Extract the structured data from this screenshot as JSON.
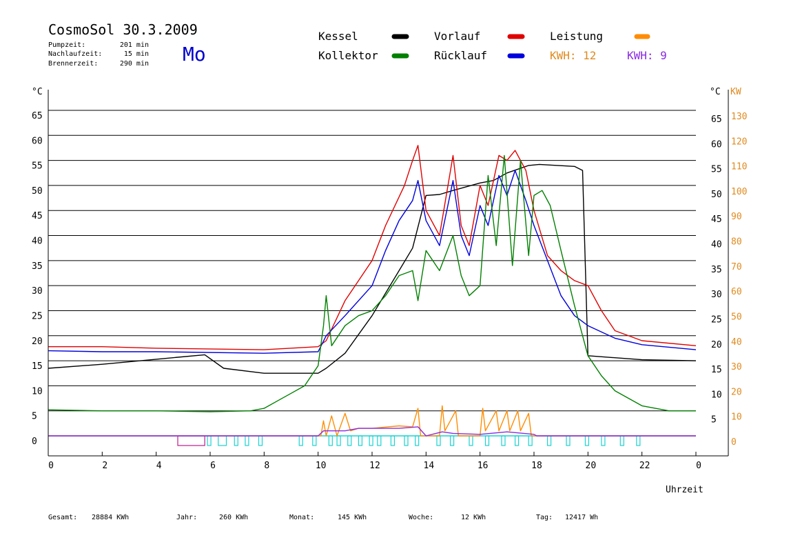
{
  "header": {
    "title": "CosmoSol 30.3.2009",
    "day": "Mo",
    "info": [
      {
        "label": "Pumpzeit:",
        "value": "201 min"
      },
      {
        "label": "Nachlaufzeit:",
        "value": "15 min"
      },
      {
        "label": "Brennerzeit:",
        "value": "290 min"
      }
    ]
  },
  "legend": [
    {
      "label": "Kessel",
      "color": "#000000"
    },
    {
      "label": "Vorlauf",
      "color": "#e00000"
    },
    {
      "label": "Leistung",
      "color": "#ff8c00"
    },
    {
      "label": "Kollektor",
      "color": "#008000"
    },
    {
      "label": "Rücklauf",
      "color": "#0000dd"
    }
  ],
  "kwh": [
    {
      "text": "KWH: 12",
      "color": "#e08a1e"
    },
    {
      "text": "KWH: 9",
      "color": "#8a2be2"
    }
  ],
  "footer": [
    {
      "label": "Gesamt:",
      "value": "28884 KWh"
    },
    {
      "label": "Jahr:",
      "value": "260 KWh"
    },
    {
      "label": "Monat:",
      "value": "145 KWh"
    },
    {
      "label": "Woche:",
      "value": "12 KWh"
    },
    {
      "label": "Tag:",
      "value": "12417 Wh"
    }
  ],
  "chart_data": {
    "type": "line",
    "xlabel": "Uhrzeit",
    "ylabel_left": "°C",
    "ylabel_right_1": "°C",
    "ylabel_right_2": "KW",
    "xlim": [
      0,
      24
    ],
    "ylim": [
      0,
      65
    ],
    "ylim_kw": [
      0,
      130
    ],
    "x_ticks": [
      "0",
      "2",
      "4",
      "6",
      "8",
      "10",
      "12",
      "14",
      "16",
      "18",
      "20",
      "22",
      "0"
    ],
    "y_ticks_left": [
      "65",
      "60",
      "55",
      "50",
      "45",
      "40",
      "35",
      "30",
      "25",
      "20",
      "15",
      "10",
      "5",
      "0"
    ],
    "y_ticks_right": [
      "65",
      "60",
      "55",
      "50",
      "45",
      "40",
      "35",
      "30",
      "25",
      "20",
      "15",
      "10",
      "5"
    ],
    "y_ticks_kw": [
      "130",
      "120",
      "110",
      "100",
      "90",
      "80",
      "70",
      "60",
      "50",
      "40",
      "30",
      "20",
      "10",
      "0"
    ],
    "grid": true,
    "series": [
      {
        "name": "Kessel",
        "color": "#000000",
        "points": [
          [
            0,
            13.5
          ],
          [
            2,
            14.3
          ],
          [
            4,
            15.3
          ],
          [
            5.8,
            16.2
          ],
          [
            6.5,
            13.5
          ],
          [
            8,
            12.5
          ],
          [
            10,
            12.5
          ],
          [
            10.3,
            13.5
          ],
          [
            11,
            16.5
          ],
          [
            12,
            24
          ],
          [
            13,
            33
          ],
          [
            13.5,
            37.5
          ],
          [
            14,
            48
          ],
          [
            14.5,
            48.2
          ],
          [
            15,
            49
          ],
          [
            16,
            50.5
          ],
          [
            16.5,
            51
          ],
          [
            17,
            52.5
          ],
          [
            17.8,
            54
          ],
          [
            18.2,
            54.2
          ],
          [
            19.5,
            53.8
          ],
          [
            19.8,
            53
          ],
          [
            20,
            16
          ],
          [
            22,
            15.2
          ],
          [
            24,
            15
          ]
        ]
      },
      {
        "name": "Vorlauf",
        "color": "#e00000",
        "points": [
          [
            0,
            17.8
          ],
          [
            2,
            17.8
          ],
          [
            4,
            17.5
          ],
          [
            8,
            17.2
          ],
          [
            10,
            17.8
          ],
          [
            10.3,
            19
          ],
          [
            11,
            27
          ],
          [
            11.5,
            31
          ],
          [
            12,
            35
          ],
          [
            12.5,
            42
          ],
          [
            13.2,
            50
          ],
          [
            13.5,
            55
          ],
          [
            13.7,
            58
          ],
          [
            14,
            45
          ],
          [
            14.5,
            40
          ],
          [
            15,
            56
          ],
          [
            15.3,
            42
          ],
          [
            15.6,
            38
          ],
          [
            16,
            50
          ],
          [
            16.3,
            46
          ],
          [
            16.7,
            56
          ],
          [
            17,
            55
          ],
          [
            17.3,
            57
          ],
          [
            17.7,
            53
          ],
          [
            18,
            45
          ],
          [
            18.5,
            36
          ],
          [
            19,
            33
          ],
          [
            19.5,
            31
          ],
          [
            20,
            30
          ],
          [
            20.5,
            25
          ],
          [
            21,
            21
          ],
          [
            22,
            19
          ],
          [
            24,
            18
          ]
        ]
      },
      {
        "name": "Rücklauf",
        "color": "#0000dd",
        "points": [
          [
            0,
            17
          ],
          [
            2,
            16.8
          ],
          [
            4,
            16.8
          ],
          [
            8,
            16.5
          ],
          [
            10,
            16.8
          ],
          [
            10.3,
            20
          ],
          [
            11,
            24
          ],
          [
            12,
            30
          ],
          [
            12.5,
            37
          ],
          [
            13,
            43
          ],
          [
            13.5,
            47
          ],
          [
            13.7,
            51
          ],
          [
            14,
            43
          ],
          [
            14.5,
            38
          ],
          [
            15,
            51
          ],
          [
            15.3,
            40
          ],
          [
            15.6,
            36
          ],
          [
            16,
            46
          ],
          [
            16.3,
            42
          ],
          [
            16.7,
            52
          ],
          [
            17,
            48
          ],
          [
            17.3,
            53
          ],
          [
            17.7,
            47
          ],
          [
            18,
            42
          ],
          [
            18.5,
            35
          ],
          [
            19,
            28
          ],
          [
            19.5,
            24
          ],
          [
            20,
            22
          ],
          [
            21,
            19.5
          ],
          [
            22,
            18.2
          ],
          [
            24,
            17.2
          ]
        ]
      },
      {
        "name": "Kollektor",
        "color": "#008000",
        "points": [
          [
            0,
            5.2
          ],
          [
            2,
            5
          ],
          [
            4,
            5
          ],
          [
            6,
            4.8
          ],
          [
            7.5,
            5
          ],
          [
            8,
            5.5
          ],
          [
            8.5,
            7
          ],
          [
            9,
            8.5
          ],
          [
            9.5,
            10
          ],
          [
            10,
            14
          ],
          [
            10.2,
            22
          ],
          [
            10.3,
            28
          ],
          [
            10.5,
            18
          ],
          [
            11,
            22
          ],
          [
            11.5,
            24
          ],
          [
            12,
            25
          ],
          [
            12.5,
            28
          ],
          [
            13,
            32
          ],
          [
            13.5,
            33
          ],
          [
            13.7,
            27
          ],
          [
            14,
            37
          ],
          [
            14.5,
            33
          ],
          [
            15,
            40
          ],
          [
            15.3,
            32
          ],
          [
            15.6,
            28
          ],
          [
            16,
            30
          ],
          [
            16.3,
            52
          ],
          [
            16.6,
            38
          ],
          [
            16.9,
            56
          ],
          [
            17.2,
            34
          ],
          [
            17.5,
            55
          ],
          [
            17.8,
            36
          ],
          [
            18,
            48
          ],
          [
            18.3,
            49
          ],
          [
            18.6,
            46
          ],
          [
            19,
            37
          ],
          [
            19.5,
            26
          ],
          [
            20,
            16
          ],
          [
            20.5,
            12
          ],
          [
            21,
            9
          ],
          [
            22,
            6
          ],
          [
            23,
            5
          ],
          [
            24,
            5
          ]
        ]
      },
      {
        "name": "Leistung",
        "color": "#ff8c00",
        "points": [
          [
            0,
            0
          ],
          [
            10,
            0
          ],
          [
            10.1,
            0
          ],
          [
            10.2,
            3
          ],
          [
            10.3,
            0
          ],
          [
            10.5,
            4
          ],
          [
            10.7,
            0
          ],
          [
            11,
            4.5
          ],
          [
            11.2,
            1
          ],
          [
            11.5,
            1.5
          ],
          [
            12,
            1.5
          ],
          [
            13,
            2
          ],
          [
            13.5,
            1.8
          ],
          [
            13.7,
            5.5
          ],
          [
            13.8,
            0
          ],
          [
            14.5,
            0
          ],
          [
            14.6,
            6
          ],
          [
            14.7,
            1
          ],
          [
            15.1,
            5
          ],
          [
            15.2,
            0
          ],
          [
            16,
            0
          ],
          [
            16.1,
            5.5
          ],
          [
            16.2,
            1
          ],
          [
            16.6,
            5
          ],
          [
            16.7,
            1
          ],
          [
            17,
            5
          ],
          [
            17.1,
            1
          ],
          [
            17.4,
            5
          ],
          [
            17.5,
            1
          ],
          [
            17.8,
            4.5
          ],
          [
            17.9,
            0
          ],
          [
            24,
            0
          ]
        ]
      },
      {
        "name": "Leistung 2",
        "color": "#8a2be2",
        "points": [
          [
            0,
            0
          ],
          [
            10,
            0
          ],
          [
            10.2,
            1
          ],
          [
            11,
            1
          ],
          [
            11.5,
            1.5
          ],
          [
            13,
            1.5
          ],
          [
            13.7,
            1.8
          ],
          [
            14,
            0
          ],
          [
            14.6,
            0.8
          ],
          [
            15,
            0.5
          ],
          [
            16,
            0.3
          ],
          [
            17,
            0.8
          ],
          [
            18,
            0.3
          ],
          [
            18.1,
            0
          ],
          [
            24,
            0
          ]
        ]
      }
    ],
    "pump_intervals": [
      [
        4.8,
        5.8
      ],
      [
        5.9,
        6.0
      ],
      [
        6.3,
        6.6
      ],
      [
        6.9,
        7.0
      ],
      [
        7.3,
        7.4
      ],
      [
        7.8,
        7.9
      ],
      [
        9.3,
        9.4
      ],
      [
        9.8,
        9.9
      ],
      [
        10.4,
        10.5
      ],
      [
        10.7,
        10.8
      ],
      [
        11.1,
        11.2
      ],
      [
        11.5,
        11.6
      ],
      [
        11.9,
        12.0
      ],
      [
        12.2,
        12.3
      ],
      [
        12.7,
        12.8
      ],
      [
        13.2,
        13.3
      ],
      [
        13.6,
        13.7
      ],
      [
        14.4,
        14.5
      ],
      [
        14.9,
        15.0
      ],
      [
        15.6,
        15.7
      ],
      [
        16.2,
        16.3
      ],
      [
        16.8,
        16.9
      ],
      [
        17.3,
        17.4
      ],
      [
        17.8,
        17.9
      ],
      [
        18.5,
        18.6
      ],
      [
        19.2,
        19.3
      ],
      [
        19.9,
        20.0
      ],
      [
        20.5,
        20.6
      ],
      [
        21.2,
        21.3
      ],
      [
        21.8,
        21.9
      ]
    ]
  }
}
